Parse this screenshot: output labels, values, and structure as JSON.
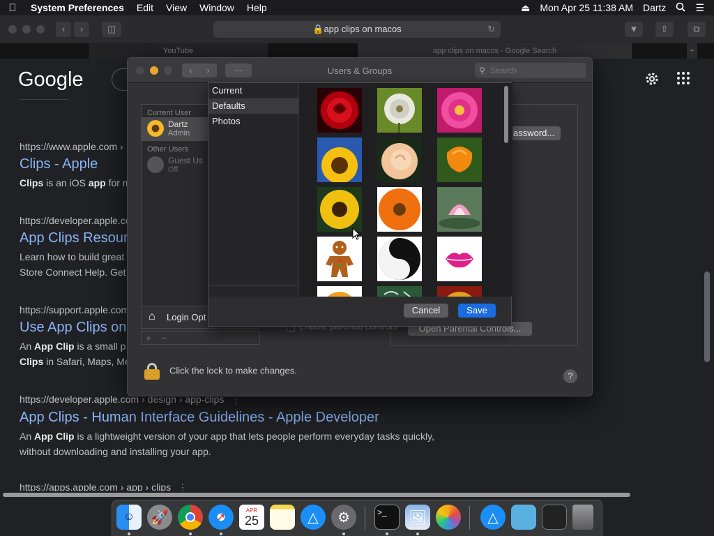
{
  "menubar": {
    "app_name": "System Preferences",
    "items": [
      "Edit",
      "View",
      "Window",
      "Help"
    ],
    "date_time": "Mon Apr 25  11:38 AM",
    "user": "Dartz"
  },
  "safari": {
    "address": "app clips on macos",
    "tabs": [
      "YouTube",
      "app clips on macos - Google Search"
    ]
  },
  "google": {
    "logo": "Google",
    "results": [
      {
        "url": "https://www.apple.com ›",
        "title": "Clips - Apple",
        "snippet_html": "<b>Clips</b> is an iOS <b>app</b> for m"
      },
      {
        "url": "https://developer.apple.co",
        "title": "App Clips Resour",
        "snippet_html": "Learn how to build great<br>Store Connect Help. Get"
      },
      {
        "url": "https://support.apple.com",
        "title": "Use App Clips on",
        "snippet_html": "An <b>App Clip</b> is a small p<br><b>Clips</b> in Safari, Maps, Me"
      },
      {
        "url": "https://developer.apple.com › design › app-clips",
        "title": "App Clips - Human Interface Guidelines - Apple Developer",
        "snippet_html": "An <b>App Clip</b> is a lightweight version of your app that lets people perform everyday tasks quickly,<br>without downloading and installing your app."
      },
      {
        "url": "https://apps.apple.com › app › clips",
        "title": "",
        "snippet_html": ""
      }
    ]
  },
  "syspref": {
    "title": "Users & Groups",
    "search_placeholder": "Search",
    "current_user_header": "Current User",
    "current_user_name": "Dartz",
    "current_user_role": "Admin",
    "other_users_header": "Other Users",
    "guest_name": "Guest Us",
    "guest_status": "Off",
    "login_options": "Login Opt",
    "change_password": "assword...",
    "enable_parental": "Enable parental controls",
    "open_parental": "Open Parental Controls...",
    "lock_text": "Click the lock to make changes.",
    "help": "?"
  },
  "picker": {
    "categories": [
      "Current",
      "Defaults",
      "Photos"
    ],
    "selected_category": "Defaults",
    "cancel_label": "Cancel",
    "save_label": "Save",
    "pictures": [
      "red-rose",
      "dandelion",
      "pink-dahlia",
      "sunflower",
      "peach-rose",
      "orange-poppy",
      "yellow-daisy",
      "orange-gerbera",
      "water-lily",
      "gingerbread-man",
      "yin-yang",
      "lipstick-kiss",
      "orange-slice",
      "chalkboard",
      "gold-medal"
    ]
  },
  "dock": {
    "apps": [
      "Finder",
      "Launchpad",
      "Chrome",
      "Safari",
      "Calendar",
      "Notes",
      "App Store",
      "System Preferences",
      "Terminal",
      "Preview",
      "Photos",
      "App Store",
      "Folder",
      "Window",
      "Trash"
    ],
    "calendar_month": "APR",
    "calendar_day": "25"
  },
  "colors": {
    "accent": "#1b6ce0",
    "link": "#8ab4f8",
    "close": "#4a4a4c",
    "minimize": "#e9a52f"
  }
}
